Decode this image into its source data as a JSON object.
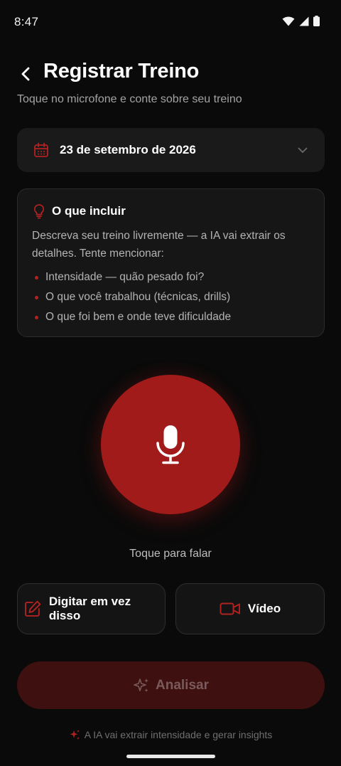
{
  "status_bar": {
    "time": "8:47",
    "icons": [
      "wifi-icon",
      "signal-icon",
      "battery-icon"
    ]
  },
  "header": {
    "back_icon": "arrow-left-icon",
    "title": "Registrar Treino",
    "subtitle": "Toque no microfone e conte sobre seu treino"
  },
  "date_picker": {
    "icon": "calendar-icon",
    "value": "23 de setembro de 2026",
    "chevron_icon": "chevron-down-icon"
  },
  "include_card": {
    "icon": "lightbulb-icon",
    "title": "O que incluir",
    "description": "Descreva seu treino livremente — a IA vai extrair os detalhes. Tente mencionar:",
    "tips": [
      "Intensidade — quão pesado foi?",
      "O que você trabalhou (técnicas, drills)",
      "O que foi bem e onde teve dificuldade"
    ]
  },
  "mic": {
    "icon": "microphone-icon",
    "hint": "Toque para falar"
  },
  "options": {
    "type_label": "Digitar em vez disso",
    "type_icon": "edit-icon",
    "video_label": "Vídeo",
    "video_icon": "video-camera-icon"
  },
  "analyze": {
    "label": "Analisar",
    "icon": "sparkles-icon",
    "enabled": false
  },
  "footer": {
    "note": "A IA vai extrair intensidade e gerar insights",
    "icon": "sparkles-icon"
  },
  "colors": {
    "accent": "#a21b1b",
    "background": "#0a0a0a",
    "card": "#1a1a1a",
    "analyze_disabled": "#3e1010"
  }
}
